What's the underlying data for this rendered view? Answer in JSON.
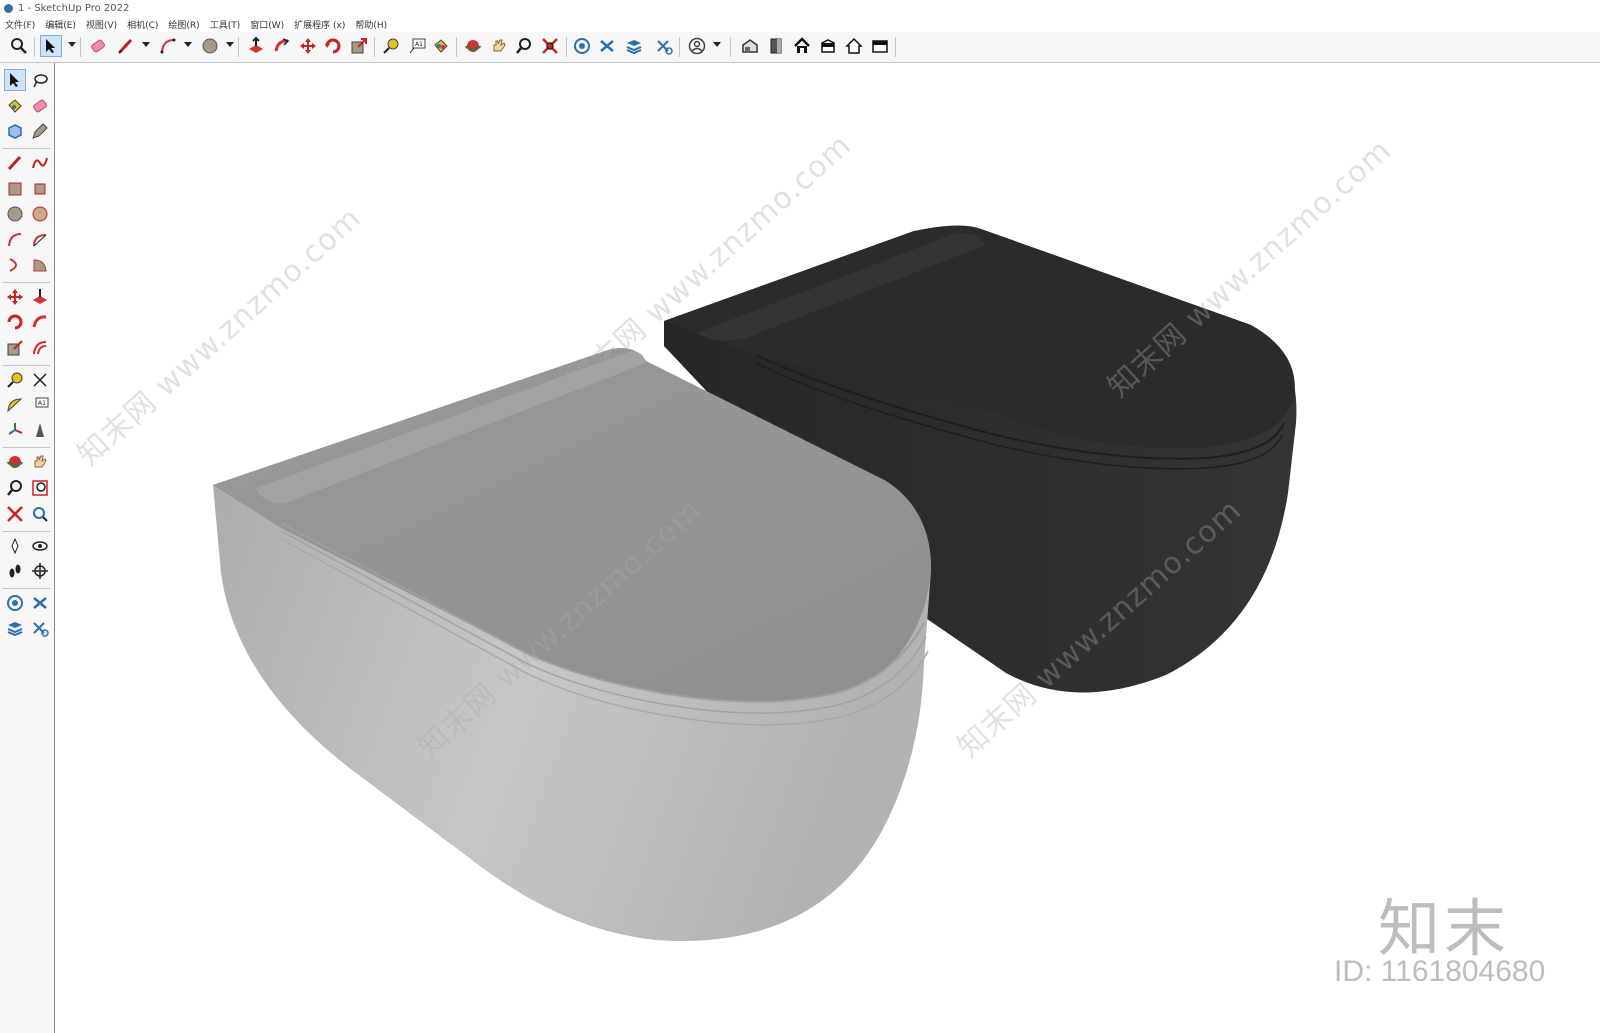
{
  "window": {
    "title": "1 - SketchUp Pro 2022"
  },
  "menu": [
    "文件(F)",
    "编辑(E)",
    "视图(V)",
    "相机(C)",
    "绘图(R)",
    "工具(T)",
    "窗口(W)",
    "扩展程序 (x)",
    "帮助(H)"
  ],
  "toolbar": {
    "tools": [
      "search",
      "select",
      "eraser",
      "pencil",
      "arc",
      "circle",
      "push-pull",
      "follow-me",
      "move",
      "rotate",
      "scale",
      "tape-measure",
      "text",
      "paint-bucket",
      "orbit",
      "pan",
      "zoom",
      "zoom-extents",
      "tags",
      "section-plane",
      "layers",
      "display-section",
      "account",
      "iso-view",
      "front-view",
      "top-view",
      "right-view",
      "home-view",
      "back-view"
    ],
    "active_tool": "select"
  },
  "sidebar": {
    "active_tool": "select"
  },
  "viewport": {
    "watermark_text": [
      "知末网 www.znzmo.com"
    ],
    "logo_text": "知末",
    "id_text": "ID: 1161804680",
    "colors": {
      "light_toilet": "#b8b8b8",
      "dark_toilet": "#2f2f2f"
    }
  }
}
